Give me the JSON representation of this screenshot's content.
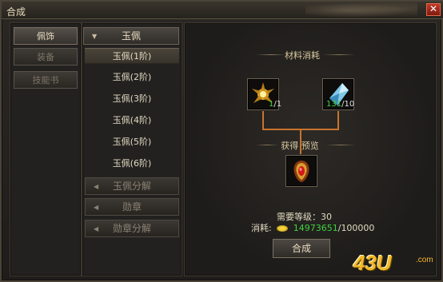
{
  "window": {
    "title": "合成",
    "close_label": "✕"
  },
  "categories": [
    {
      "label": "佩饰",
      "active": true
    },
    {
      "label": "装备",
      "active": false
    },
    {
      "label": "技能书",
      "active": false
    }
  ],
  "tree": {
    "expanded_group": {
      "label": "玉佩",
      "arrow": "▼"
    },
    "items": [
      "玉佩(1阶)",
      "玉佩(2阶)",
      "玉佩(3阶)",
      "玉佩(4阶)",
      "玉佩(5阶)",
      "玉佩(6阶)"
    ],
    "selected_index": 0,
    "collapsed_groups": [
      {
        "label": "玉佩分解",
        "arrow": "◀"
      },
      {
        "label": "勋章",
        "arrow": "◀"
      },
      {
        "label": "勋章分解",
        "arrow": "◀"
      }
    ]
  },
  "recipe": {
    "materials_label": "材料消耗",
    "preview_label": "获得  预览",
    "materials": [
      {
        "icon": "golden-sun-ornament-icon",
        "have": "1",
        "need": "1"
      },
      {
        "icon": "blue-crystal-icon",
        "have": "131",
        "need": "10"
      }
    ],
    "result": {
      "icon": "red-jade-pendant-icon"
    },
    "level_label": "需要等级：",
    "level_value": "30",
    "cost_label": "消耗:",
    "cost_have": "14973651",
    "cost_need": "100000",
    "craft_button": "合成"
  },
  "watermark": {
    "text": "43U",
    "sub": ".com"
  },
  "colors": {
    "accent_green": "#3fd23f",
    "close_red": "#c23a28",
    "connector": "#c8742e"
  }
}
